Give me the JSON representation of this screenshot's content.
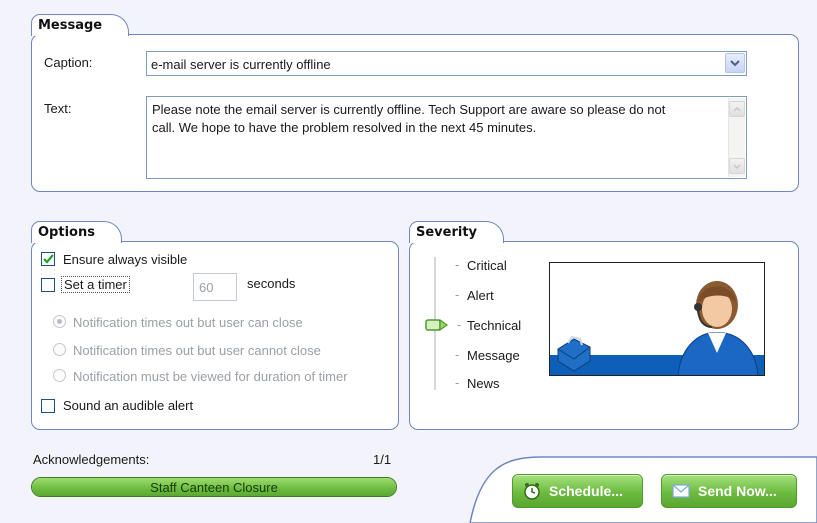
{
  "message": {
    "section_title": "Message",
    "caption_label": "Caption:",
    "caption_value": "e-mail server is currently offline",
    "text_label": "Text:",
    "text_line1": "Please note the email server is currently offline. Tech Support are aware so please do not",
    "text_line2": "call. We hope to have the problem resolved in the next 45 minutes."
  },
  "options": {
    "section_title": "Options",
    "ensure_visible_label": "Ensure always visible",
    "ensure_visible_checked": true,
    "set_timer_label": "Set a timer",
    "set_timer_checked": false,
    "timer_value": "60",
    "timer_units": "seconds",
    "radio_1": "Notification times out but user can close",
    "radio_2": "Notification times out but user cannot close",
    "radio_3": "Notification must be viewed for duration of timer",
    "radio_selected": 1,
    "sound_alert_label": "Sound an audible alert",
    "sound_alert_checked": false
  },
  "severity": {
    "section_title": "Severity",
    "levels": [
      "Critical",
      "Alert",
      "Technical",
      "Message",
      "News"
    ],
    "selected": "Technical",
    "selected_index": 2
  },
  "acknowledgements": {
    "label": "Acknowledgements:",
    "count": "1/1",
    "progress_label": "Staff Canteen Closure",
    "progress_fraction": 1.0
  },
  "buttons": {
    "schedule": "Schedule...",
    "send_now": "Send Now..."
  },
  "colors": {
    "panel_border": "#6f86c0",
    "accent_green": "#6cbc3f",
    "picture_blue": "#0d5fb7"
  },
  "icons": {
    "caption_dropdown": "chevron-down-icon",
    "schedule": "clock-icon",
    "send": "envelope-icon",
    "severity_pointer": "arrow-pointer-icon"
  }
}
